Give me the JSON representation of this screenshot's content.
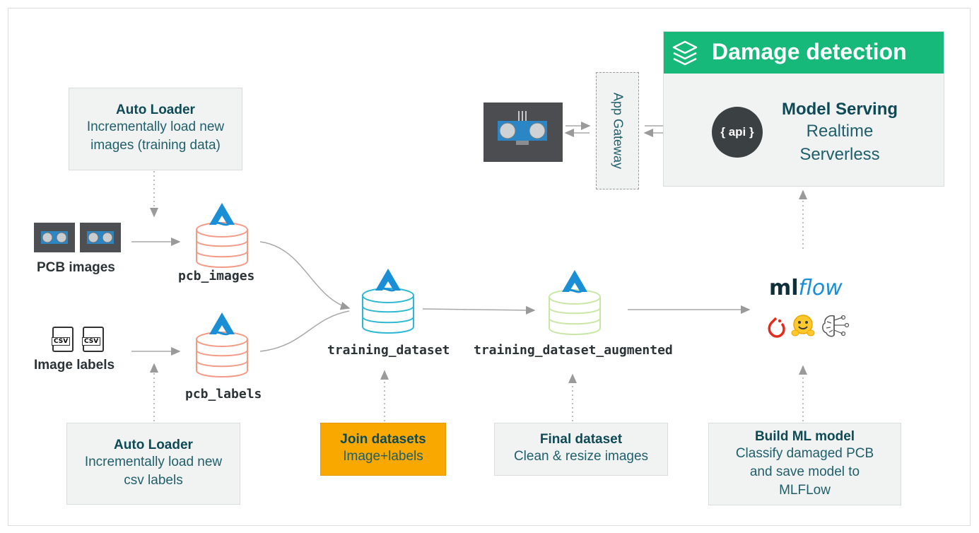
{
  "auto_loader_images": {
    "title": "Auto Loader",
    "desc_line1": "Incrementally load new",
    "desc_line2": "images (training data)"
  },
  "auto_loader_labels": {
    "title": "Auto Loader",
    "desc_line1": "Incrementally load new",
    "desc_line2": "csv labels"
  },
  "sources": {
    "pcb_images": "PCB images",
    "image_labels": "Image labels",
    "csv_icon_text": "CSV"
  },
  "tables": {
    "pcb_images": "pcb_images",
    "pcb_labels": "pcb_labels",
    "training_dataset": "training_dataset",
    "training_dataset_augmented": "training_dataset_augmented"
  },
  "join_step": {
    "title": "Join datasets",
    "desc": "Image+labels"
  },
  "final_step": {
    "title": "Final dataset",
    "desc": "Clean & resize images"
  },
  "build_step": {
    "title": "Build ML model",
    "desc_line1": "Classify damaged PCB",
    "desc_line2": "and save model to",
    "desc_line3": "MLFLow"
  },
  "gateway": {
    "label": "App Gateway"
  },
  "damage_detection": {
    "header": "Damage detection",
    "serving_title": "Model Serving",
    "serving_line1": "Realtime",
    "serving_line2": "Serverless",
    "api_badge": "{ api }"
  },
  "mlflow": {
    "logo_ml": "ml",
    "logo_flow": "flow"
  },
  "colors": {
    "header_green": "#16b979",
    "join_orange": "#f9a800",
    "db_salmon": "#f29b86",
    "db_cyan": "#2fb8d3",
    "db_lime": "#c9e7a6",
    "delta_blue": "#1a8fd6",
    "api_dark": "#3b4043"
  }
}
